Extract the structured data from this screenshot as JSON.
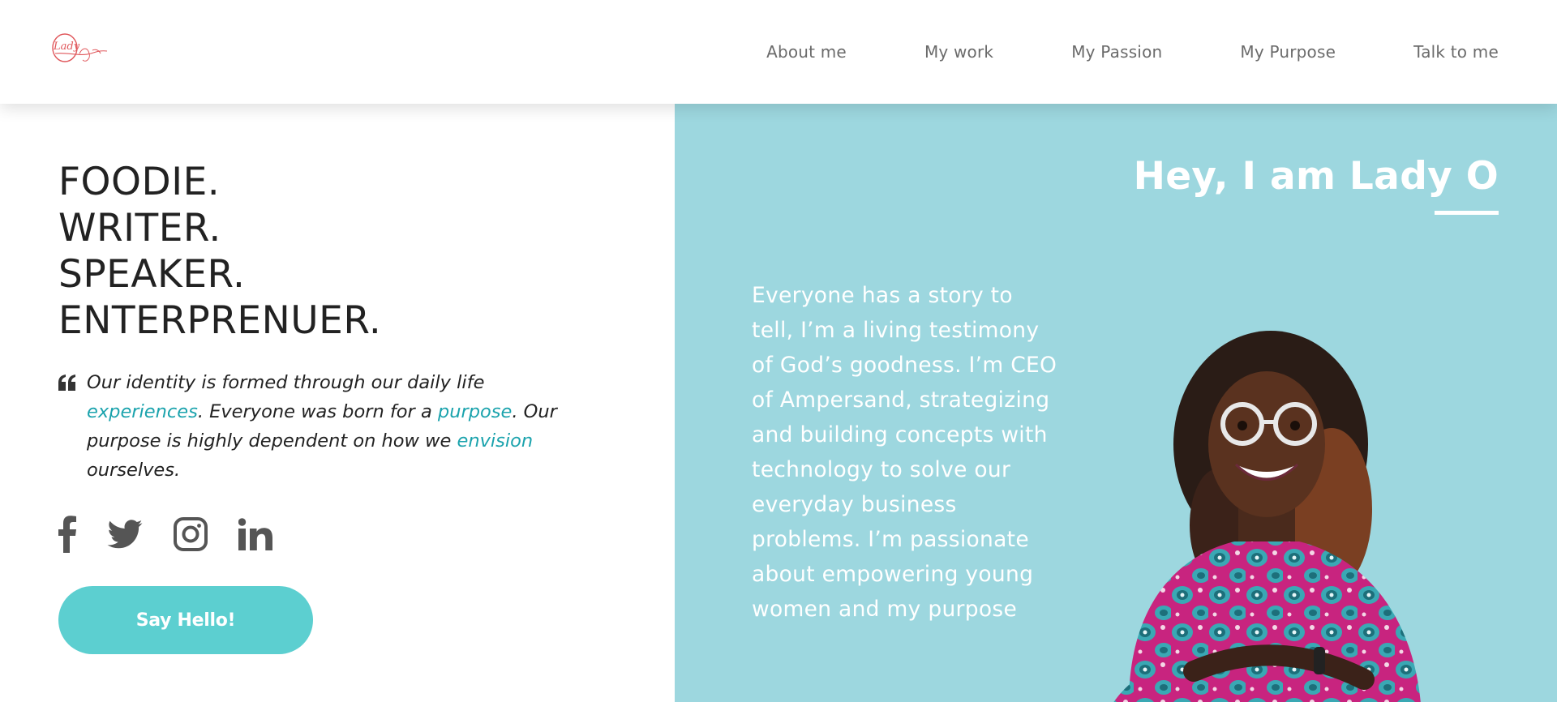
{
  "header": {
    "logo_text": "Lady",
    "nav": [
      {
        "label": "About me"
      },
      {
        "label": "My work"
      },
      {
        "label": "My Passion"
      },
      {
        "label": "My Purpose"
      },
      {
        "label": "Talk to me"
      }
    ]
  },
  "hero_left": {
    "roles": [
      "FOODIE.",
      "WRITER.",
      "SPEAKER.",
      "ENTERPRENUER."
    ],
    "quote": {
      "icon": "quote-icon",
      "part1": "Our identity is formed through our daily life ",
      "hl1": "experiences",
      "part2": ". Everyone was born for a ",
      "hl2": "purpose",
      "part3": ". Our purpose is highly dependent on how we ",
      "hl3": "envision",
      "part4": " ourselves."
    },
    "social": [
      "facebook-icon",
      "twitter-icon",
      "instagram-icon",
      "linkedin-icon"
    ],
    "cta_label": "Say Hello!"
  },
  "hero_right": {
    "title": "Hey, I am Lady O",
    "bio": "Everyone has a story to tell, I’m a living testimony of God’s goodness. I’m CEO of Ampersand, strategizing and building concepts with technology to solve our everyday business problems. I’m passionate about empowering young women and my purpose"
  },
  "colors": {
    "accent": "#5ccfd0",
    "highlight": "#1ba3ad",
    "panel": "#9dd7df",
    "logo": "#e0575b",
    "text": "#222222",
    "nav": "#6b6b6b",
    "icons": "#555555"
  }
}
